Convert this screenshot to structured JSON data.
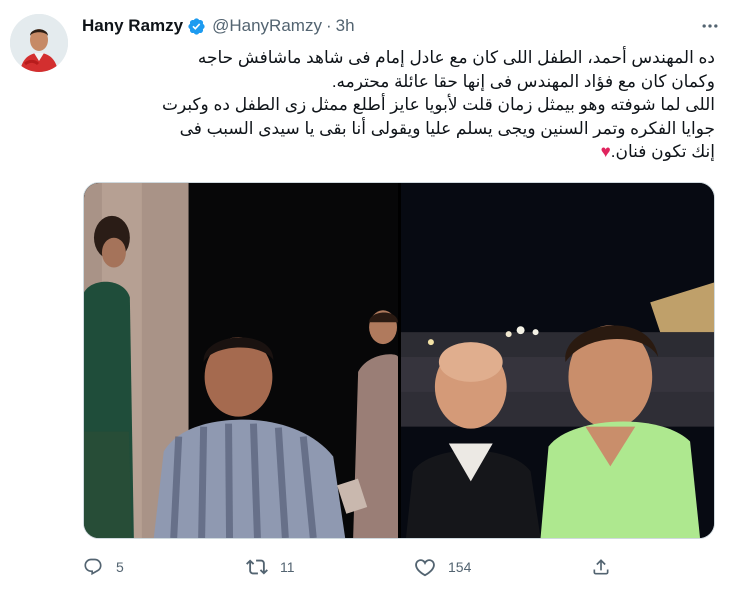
{
  "author": {
    "display_name": "Hany Ramzy",
    "handle": "@HanyRamzy",
    "separator": "·",
    "time": "3h",
    "verified": true
  },
  "tweet": {
    "lines": [
      "ده المهندس أحمد، الطفل اللى كان مع عادل إمام فى شاهد ماشافش حاجه",
      "وكمان كان مع فؤاد المهندس فى إنها حقا عائلة محترمه.",
      "اللى لما شوفته وهو بيمثل زمان قلت لأبويا عايز أطلع ممثل زى الطفل ده وكبرت",
      "جوايا الفكره وتمر السنين ويجى يسلم عليا ويقولى أنا بقى يا سيدى السبب فى"
    ],
    "last_line": "إنك تكون فنان.",
    "emoji": "♥"
  },
  "media": {
    "photos": [
      "classic-film-still",
      "selfie-two-men"
    ]
  },
  "actions": {
    "replies": "5",
    "retweets": "11",
    "likes": "154"
  },
  "colors": {
    "text": "#0f1419",
    "secondary": "#536471",
    "verified": "#1d9bf0",
    "heart": "#e0245e",
    "border": "#cfd9de"
  }
}
